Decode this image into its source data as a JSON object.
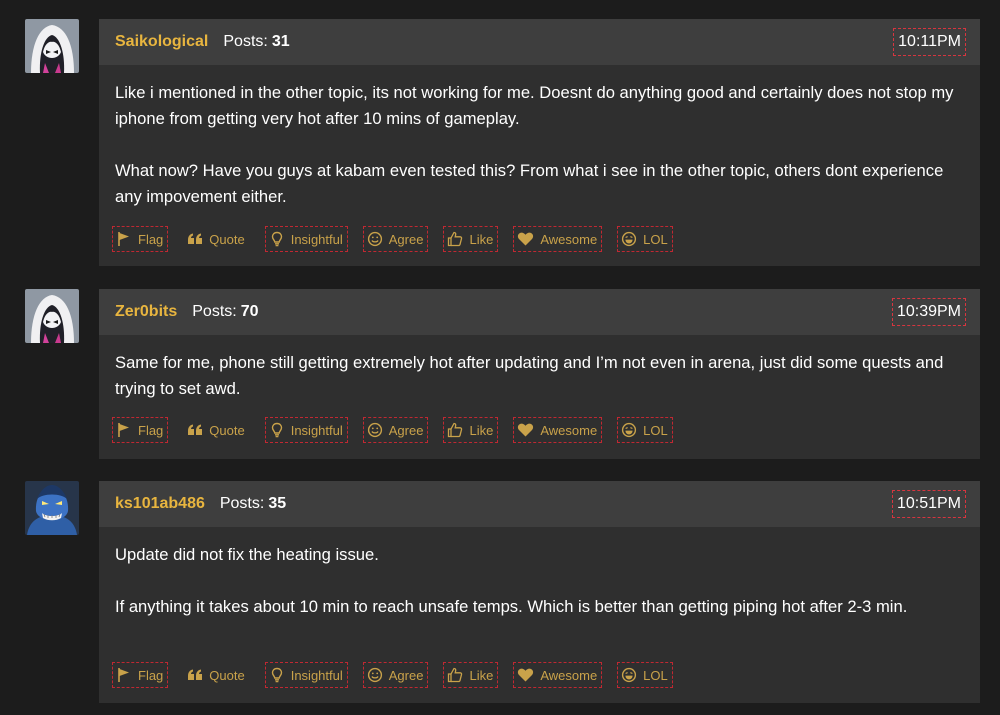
{
  "posts": [
    {
      "username": "Saikological",
      "posts_label": "Posts:",
      "posts_count": "31",
      "time": "10:11PM",
      "avatar_icon": "spider-gwen-avatar",
      "paragraphs": [
        "Like i mentioned in the other topic, its not working for me. Doesnt do anything good and certainly does not stop my iphone from getting very hot after 10 mins of gameplay.",
        "What now? Have you guys at kabam even tested this? From what i see in the other topic, others dont experience any impovement either."
      ]
    },
    {
      "username": "Zer0bits",
      "posts_label": "Posts:",
      "posts_count": "70",
      "time": "10:39PM",
      "avatar_icon": "spider-gwen-avatar",
      "paragraphs": [
        "Same for me, phone still getting extremely hot after updating and I’m not even in arena, just did some quests and trying to set awd."
      ]
    },
    {
      "username": "ks101ab486",
      "posts_label": "Posts:",
      "posts_count": "35",
      "time": "10:51PM",
      "avatar_icon": "beast-avatar",
      "paragraphs": [
        "Update did not fix the heating issue.",
        "If anything it takes about 10 min to reach unsafe temps. Which is better than getting piping hot after 2-3 min."
      ]
    }
  ],
  "reactions": [
    {
      "label": "Flag",
      "icon": "flag-icon"
    },
    {
      "label": "Quote",
      "icon": "quote-icon"
    },
    {
      "label": "Insightful",
      "icon": "lightbulb-icon"
    },
    {
      "label": "Agree",
      "icon": "smile-icon"
    },
    {
      "label": "Like",
      "icon": "thumbs-up-icon"
    },
    {
      "label": "Awesome",
      "icon": "heart-icon"
    },
    {
      "label": "LOL",
      "icon": "laugh-icon"
    }
  ],
  "colors": {
    "background": "#1c1c1c",
    "card": "#2f2f2f",
    "card_header": "#3e3e3e",
    "username": "#e8b53f",
    "reaction": "#c9a24a",
    "highlight_border": "#d8353f"
  }
}
